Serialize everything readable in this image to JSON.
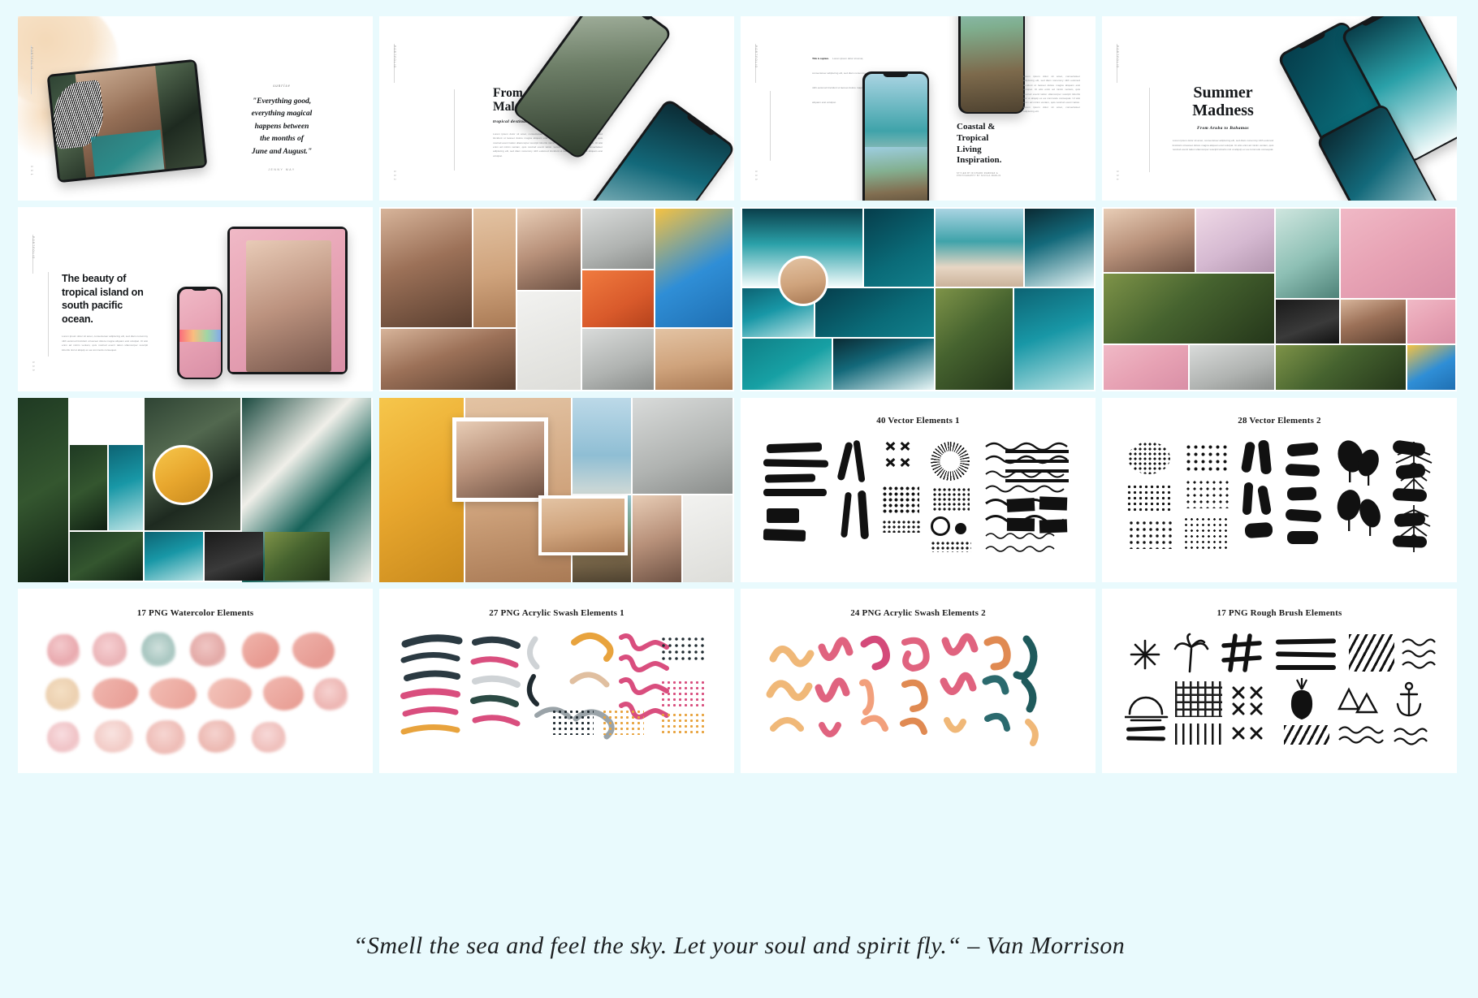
{
  "meta": {
    "background_color": "#e9fafd",
    "slide_background": "#ffffff",
    "text_color": "#14171a"
  },
  "slides": [
    {
      "id": "slide-quote-tablet",
      "row": 1,
      "col": 1,
      "side_label": "PORTFOLIO",
      "page_label": "0 0 1",
      "quote_mark": "sunrise",
      "quote_lines": [
        "\"Everything good,",
        "everything magical",
        "happens between",
        "the months of",
        "June and August.\""
      ],
      "attribution": "JENNY MAY"
    },
    {
      "id": "slide-sheycelles",
      "row": 1,
      "col": 2,
      "side_label": "PORTFOLIO",
      "page_label": "0 0 2",
      "title": "From Sheycelles to Maldives.",
      "subtitle": "tropical destination",
      "body": "Lorem ipsum dolor sit amet, consectetuer adipiscing elit, sed diam nonummy nibh euismod tincidunt ut laoreet dolore magna aliquam erat volutpat. Ut wisi enim ad minim veniam, quis nostrud exerci tation ullamcorper suscipit lobortis nisl ut aliquip ex ea commodo consequat. Ut wisi enim ad minim veniam, quis nostrud exerci tation. Lorem ipsum dolor sit amet, consectetuer adipiscing elit, sed diam nonummy nibh euismod tincidunt ut laoreet dolore magna aliquam erat volutpat."
    },
    {
      "id": "slide-coastal",
      "row": 1,
      "col": 3,
      "side_label": "PORTFOLIO",
      "page_label": "0 0 3",
      "caption_lead": "This is caption.",
      "caption_body": "Lorem ipsum dolor sit amet, consectetuer adipiscing elit, sed diam nonummy nibh euismod tincidunt ut laoreet dolore magna aliquam erat volutpat.",
      "title": "Coastal & Tropical Living Inspiration.",
      "credit": "STYLED BY RICHARD RAMIREZ  &  PHOTOGRAPHY BY NICOLA MARLIN",
      "body": "Lorem ipsum dolor sit amet, consectetuer adipiscing elit, sed diam nonummy nibh euismod tincidunt ut laoreet dolore magna aliquam erat volutpat. Ut wisi enim ad minim veniam, quis nostrud exerci tation ullamcorper suscipit lobortis nisl ut aliquip ex ea commodo consequat. Ut wisi enim ad minim veniam, quis nostrud exerci tation. Lorem ipsum dolor sit amet, consectetuer adipiscing elit."
    },
    {
      "id": "slide-summer-madness",
      "row": 1,
      "col": 4,
      "side_label": "PORTFOLIO",
      "page_label": "0 0 4",
      "title": "Summer Madness",
      "subtitle": "From Aruba to Bahamas",
      "body": "Lorem ipsum dolor sit amet, consectetuer adipiscing elit, sed diam nonummy nibh euismod tincidunt ut laoreet dolore magna aliquam erat volutpat. Ut wisi enim ad minim veniam, quis nostrud exerci tation ullamcorper suscipit lobortis nisl ut aliquip ex ea commodo consequat."
    },
    {
      "id": "slide-beauty-tropical",
      "row": 2,
      "col": 1,
      "side_label": "PORTFOLIO",
      "page_label": "0 0 5",
      "title": "The beauty of tropical island on south pacific ocean.",
      "body": "Lorem ipsum dolor sit amet, consectetuer adipiscing elit, sed diam nonummy nibh euismod tincidunt ut laoreet dolore magna aliquam erat volutpat. Ut wisi enim ad minim veniam, quis nostrud exerci tation ullamcorper suscipit lobortis nisl ut aliquip ex ea commodo consequat."
    },
    {
      "id": "slide-moodboard-lifestyle",
      "row": 2,
      "col": 2
    },
    {
      "id": "slide-moodboard-ocean",
      "row": 2,
      "col": 3
    },
    {
      "id": "slide-moodboard-portrait",
      "row": 2,
      "col": 4
    },
    {
      "id": "slide-moodboard-jungle",
      "row": 3,
      "col": 1
    },
    {
      "id": "slide-moodboard-travel",
      "row": 3,
      "col": 2
    },
    {
      "id": "slide-vector-1",
      "row": 3,
      "col": 3,
      "panel_title": "40 Vector Elements 1"
    },
    {
      "id": "slide-vector-2",
      "row": 3,
      "col": 4,
      "panel_title": "28 Vector Elements 2"
    },
    {
      "id": "slide-watercolor",
      "row": 4,
      "col": 1,
      "panel_title": "17 PNG Watercolor Elements"
    },
    {
      "id": "slide-acrylic-1",
      "row": 4,
      "col": 2,
      "panel_title": "27 PNG Acrylic Swash Elements 1"
    },
    {
      "id": "slide-acrylic-2",
      "row": 4,
      "col": 3,
      "panel_title": "24 PNG Acrylic Swash Elements 2"
    },
    {
      "id": "slide-rough-brush",
      "row": 4,
      "col": 4,
      "panel_title": "17 PNG Rough Brush Elements"
    }
  ],
  "footer": {
    "quote": "“Smell the sea and feel the sky. Let your soul and spirit fly.“  –  Van Morrison"
  }
}
